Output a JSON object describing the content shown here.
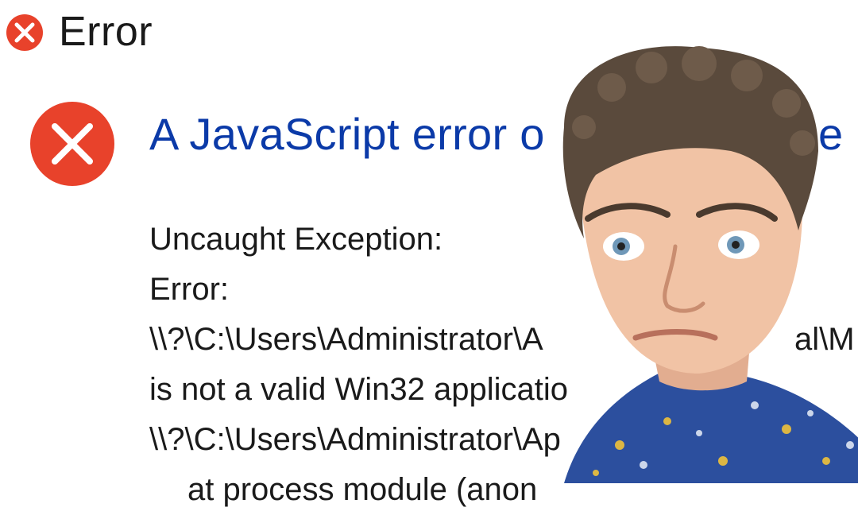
{
  "dialog": {
    "title": "Error",
    "heading": "A JavaScript error o",
    "heading_tail": "e",
    "message_lines": [
      "Uncaught Exception:",
      "Error:",
      "\\\\?\\C:\\Users\\Administrator\\A",
      "is not a valid Win32 applicatio",
      "\\\\?\\C:\\Users\\Administrator\\Ap",
      "at process module (anon"
    ],
    "line3_tail": "al\\M"
  },
  "icons": {
    "title_icon": "error-icon",
    "main_icon": "error-icon"
  },
  "colors": {
    "error_red": "#e8422b",
    "heading_blue": "#0b3aa8"
  }
}
